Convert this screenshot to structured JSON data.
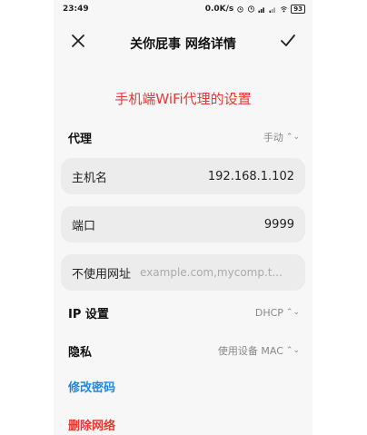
{
  "status_bar": {
    "time": "23:49",
    "net_speed": "0.0K/s",
    "battery": "93"
  },
  "header": {
    "title": "关你屁事 网络详情",
    "close_icon": "close-icon",
    "confirm_icon": "check-icon"
  },
  "annotation": "手机端WiFi代理的设置",
  "proxy": {
    "label": "代理",
    "value": "手动"
  },
  "hostname": {
    "label": "主机名",
    "value": "192.168.1.102"
  },
  "port": {
    "label": "端口",
    "value": "9999"
  },
  "bypass": {
    "label": "不使用网址",
    "placeholder": "example.com,mycomp.t..."
  },
  "ip_settings": {
    "label": "IP 设置",
    "value": "DHCP"
  },
  "privacy": {
    "label": "隐私",
    "value": "使用设备 MAC"
  },
  "actions": {
    "modify_password": "修改密码",
    "delete_network": "删除网络"
  },
  "colors": {
    "accent_blue": "#1e88e5",
    "danger_red": "#e53935",
    "field_bg": "#ececec",
    "screen_bg": "#f7f7f7"
  },
  "dropdown_indicator": "⌃⌄"
}
